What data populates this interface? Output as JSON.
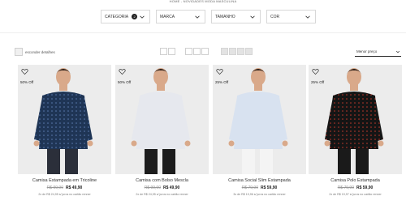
{
  "breadcrumb": "HOME - NOVIDADES MODA MASCULINA",
  "filters": [
    {
      "label": "CATEGORIA",
      "badge": "2"
    },
    {
      "label": "MARCA",
      "badge": null
    },
    {
      "label": "TAMANHO",
      "badge": null
    },
    {
      "label": "COR",
      "badge": null
    }
  ],
  "toolbar": {
    "details_label": "esconder detalhes",
    "sort_label": "Menor preço"
  },
  "products": [
    {
      "name": "Camisa Estampada em Tricoline",
      "old_price": "R$ 99,90",
      "price": "R$ 49,90",
      "discount": "50% Off",
      "installments": "2x de R$ 24,95 s/ juros no cartão renner",
      "shirt_color": "#1f3555",
      "pattern": true,
      "pants_color": "#2b2f3a"
    },
    {
      "name": "Camisa com Bolso Mescla",
      "old_price": "R$ 99,90",
      "price": "R$ 49,90",
      "discount": "50% Off",
      "installments": "2x de R$ 24,95 s/ juros no cartão renner",
      "shirt_color": "#e6e8ee",
      "pattern": false,
      "pants_color": "#1c1c1c"
    },
    {
      "name": "Camisa Social Slim Estampada",
      "old_price": "R$ 79,90",
      "price": "R$ 59,90",
      "discount": "25% Off",
      "installments": "3x de R$ 19,96 s/ juros no cartão renner",
      "shirt_color": "#d8e2f0",
      "pattern": false,
      "pants_color": "#f4f4f4"
    },
    {
      "name": "Camisa Polo Estampada",
      "old_price": "R$ 79,90",
      "price": "R$ 59,90",
      "discount": "25% Off",
      "installments": "2x de R$ 19,97 s/ juros no cartão renner",
      "shirt_color": "#151515",
      "pattern": true,
      "pants_color": "#1a1a1a"
    }
  ],
  "icons": {
    "filter_chevron": "chevron-down-icon",
    "favorite": "heart-icon",
    "sort_chevron": "chevron-down-icon"
  }
}
